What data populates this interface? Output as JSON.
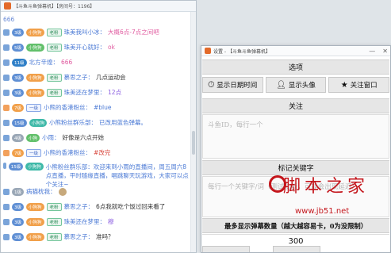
{
  "chat": {
    "title": "【斗鱼斗鱼弹幕机】【房间号：1196】",
    "top_number": "666",
    "lines": [
      {
        "lvl": "3级",
        "lvlc": "blue",
        "badge": "小狗狗",
        "badgec": "orange",
        "tag": "老粉",
        "nick": "珠美我叫小冰：",
        "msg": "大概6点-7点之间吧",
        "msgc": "pink"
      },
      {
        "lvl": "5级",
        "lvlc": "blue",
        "badge": "小狗狗",
        "badgec": "green",
        "tag": "老粉",
        "nick": "珠美开心就好：",
        "msg": "ok",
        "msgc": "pink"
      },
      {
        "lvl": "11级",
        "lvlc": "dk",
        "badge": "",
        "badgec": "",
        "tag": "",
        "nick": "北方辛煌：",
        "msg": "666",
        "msgc": "pink"
      },
      {
        "lvl": "3级",
        "lvlc": "blue",
        "badge": "小狗狗",
        "badgec": "orange",
        "tag": "老粉",
        "nick": "慕思之子：",
        "msg": "几点运动会",
        "msgc": ""
      },
      {
        "lvl": "3级",
        "lvlc": "blue",
        "badge": "小狗狗",
        "badgec": "orange",
        "tag": "老粉",
        "nick": "珠美还在梦里：",
        "msg": "12点",
        "msgc": "purple"
      },
      {
        "lvl": "7级",
        "lvlc": "orange",
        "badge": "",
        "badgec": "",
        "tag": "一级",
        "nick": "小熊的香港粉丝：",
        "msg": "#blue",
        "msgc": "blue"
      },
      {
        "lvl": "15级",
        "lvlc": "blue",
        "badge": "小狗狗",
        "badgec": "teal",
        "tag": "",
        "nick": "小熊粉丝群乐部：",
        "msg": "已改用蓝色弹幕。",
        "msgc": "blue"
      },
      {
        "lvl": "4级",
        "lvlc": "gray",
        "badge": "小狗",
        "badgec": "green",
        "tag": "",
        "nick": "小雨：",
        "msg": "好像是六点开始",
        "msgc": ""
      },
      {
        "lvl": "7级",
        "lvlc": "orange",
        "badge": "",
        "badgec": "",
        "tag": "一级",
        "nick": "小熊的香港粉丝：",
        "msg": "#改完",
        "msgc": "red"
      },
      {
        "lvl": "15级",
        "lvlc": "blue",
        "badge": "小狗狗",
        "badgec": "teal",
        "tag": "",
        "nick": "小熊粉丝群乐部：",
        "msg": "欢迎来到小雨的直播间，周五周六8点直播，平时随缘直播，唱跳聊天玩游戏，大家可以点个关注~",
        "msgc": "blue",
        "tall": true
      },
      {
        "lvl": "1级",
        "lvlc": "gray",
        "badge": "",
        "badgec": "",
        "tag": "",
        "nick": "病猫枕我：",
        "msg": "",
        "msgc": "",
        "gift": true
      },
      {
        "lvl": "3级",
        "lvlc": "blue",
        "badge": "小狗狗",
        "badgec": "orange",
        "tag": "老粉",
        "nick": "慕思之子：",
        "msg": "6点我就吃个饭过回来看了",
        "msgc": ""
      },
      {
        "lvl": "3级",
        "lvlc": "blue",
        "badge": "小狗狗",
        "badgec": "orange",
        "tag": "老粉",
        "nick": "珠美还在梦里：",
        "msg": "穆",
        "msgc": "purple"
      },
      {
        "lvl": "3级",
        "lvlc": "blue",
        "badge": "小狗狗",
        "badgec": "orange",
        "tag": "老粉",
        "nick": "慕思之子：",
        "msg": "准吗？",
        "msgc": ""
      }
    ]
  },
  "settings": {
    "title": "设置 - 【斗鱼斗鱼弹幕机】",
    "win_minimize": "—",
    "win_close": "✕",
    "section_options": "选项",
    "btn_show_date": "显示日期时间",
    "btn_show_avatar": "显示头像",
    "btn_pin_window": "关注窗口",
    "section_follow": "关注",
    "follow_placeholder": "斗鱼ID，每行一个",
    "section_keywords": "标记关键字",
    "keywords_placeholder": "每行一个关键字/词（测试功能，可能会出现延迟）",
    "section_max": "最多显示弹幕数量（越大越容易卡，0为没限制）",
    "max_value": "300"
  },
  "watermark": {
    "text": "脚本之家",
    "url": "www.jb51.net"
  },
  "icons": {
    "clock": "clock-icon",
    "user": "user-icon",
    "star": "star-icon"
  },
  "colors": {
    "accent_blue": "#4a79d5",
    "pink_msg": "#e05ca0",
    "watermark_red": "#c4161c"
  }
}
